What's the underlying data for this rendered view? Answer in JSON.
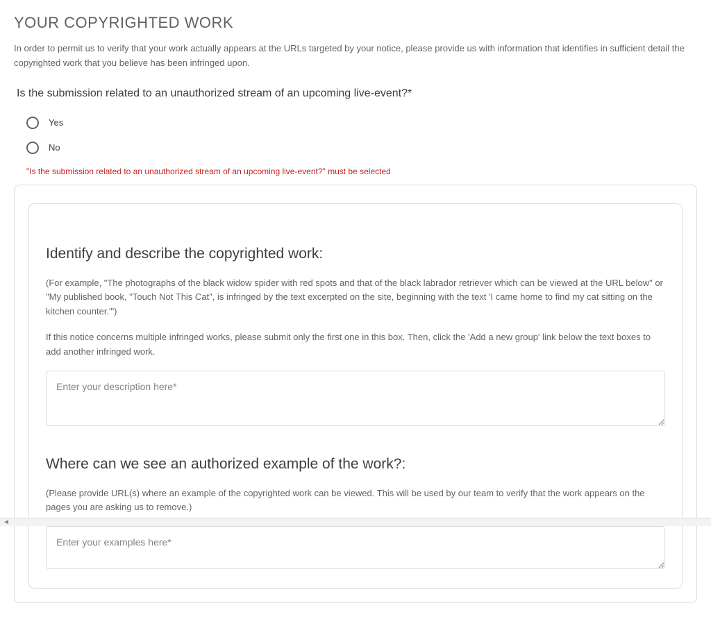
{
  "header": {
    "title": "YOUR COPYRIGHTED WORK",
    "intro": "In order to permit us to verify that your work actually appears at the URLs targeted by your notice, please provide us with information that identifies in sufficient detail the copyrighted work that you believe has been infringed upon."
  },
  "question": {
    "label": "Is the submission related to an unauthorized stream of an upcoming live-event?*",
    "options": {
      "yes": "Yes",
      "no": "No"
    },
    "error": "\"Is the submission related to an unauthorized stream of an upcoming live-event?\" must be selected"
  },
  "identify_section": {
    "heading": "Identify and describe the copyrighted work:",
    "example_text": "(For example, \"The photographs of the black widow spider with red spots and that of the black labrador retriever which can be viewed at the URL below\" or \"My published book, \"Touch Not This Cat\", is infringed by the text excerpted on the site, beginning with the text 'I came home to find my cat sitting on the kitchen counter.'\")",
    "multiple_text": "If this notice concerns multiple infringed works, please submit only the first one in this box. Then, click the 'Add a new group' link below the text boxes to add another infringed work.",
    "placeholder": "Enter your description here*"
  },
  "authorized_section": {
    "heading": "Where can we see an authorized example of the work?:",
    "helper": "(Please provide URL(s) where an example of the copyrighted work can be viewed. This will be used by our team to verify that the work appears on the pages you are asking us to remove.)",
    "placeholder": "Enter your examples here*"
  }
}
